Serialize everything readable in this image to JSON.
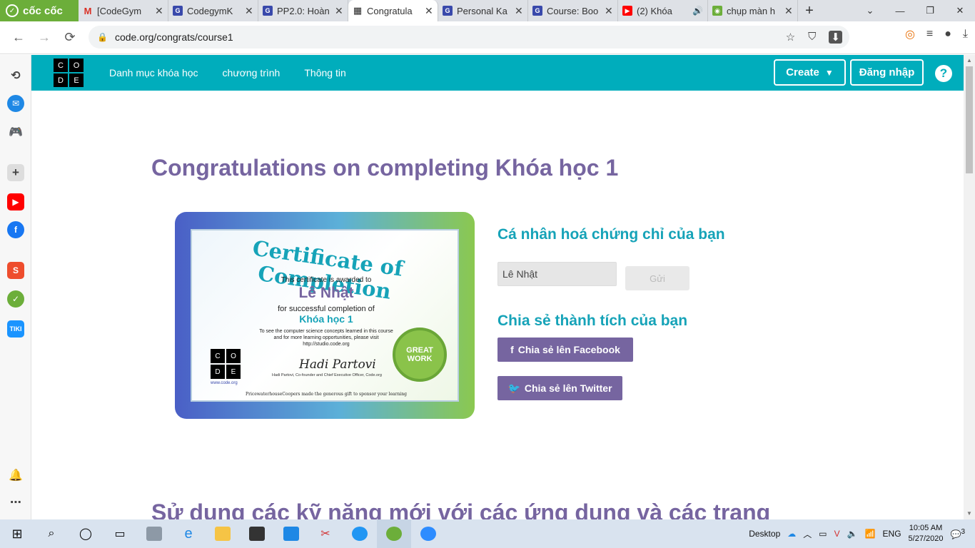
{
  "browser": {
    "brand": "cốc cốc",
    "tabs": [
      {
        "title": "[CodeGym",
        "favicon": "M",
        "color": "#d93025"
      },
      {
        "title": "CodegymK",
        "favicon": "G",
        "color": "#3949ab"
      },
      {
        "title": "PP2.0: Hoàn",
        "favicon": "G",
        "color": "#3949ab"
      },
      {
        "title": "Congratula",
        "favicon": "▦",
        "color": "#222222",
        "active": true
      },
      {
        "title": "Personal Ka",
        "favicon": "G",
        "color": "#3949ab"
      },
      {
        "title": "Course: Boo",
        "favicon": "G",
        "color": "#3949ab"
      },
      {
        "title": "(2) Khóa",
        "favicon": "▶",
        "color": "#ff0000"
      },
      {
        "title": "chụp màn h",
        "favicon": "◉",
        "color": "#6cae3a"
      }
    ],
    "url": "code.org/congrats/course1"
  },
  "site": {
    "logo": [
      "C",
      "O",
      "D",
      "E"
    ],
    "nav": [
      "Danh mục khóa học",
      "chương trình",
      "Thông tin"
    ],
    "create_label": "Create",
    "login_label": "Đăng nhập",
    "help_label": "?"
  },
  "main": {
    "heading": "Congratulations on completing Khóa học 1",
    "personalize_heading": "Cá nhân hoá chứng chỉ của bạn",
    "name_value": "Lê Nhật",
    "submit_label": "Gửi",
    "share_heading": "Chia sẻ thành tích của bạn",
    "facebook_label": "Chia sẻ lên Facebook",
    "twitter_label": "Chia sẻ lên Twitter",
    "bottom_heading": "Sử dụng các kỹ năng mới với các ứng dụng và các trang"
  },
  "certificate": {
    "title": "Certificate of Completion",
    "awarded": "This certificate is awarded to",
    "name": "Lê Nhật",
    "for_line": "for successful completion of",
    "course": "Khóa học 1",
    "note1": "To see the computer science concepts learned in this course",
    "note2": "and for more learning opportunities, please visit",
    "note3": "http://studio.code.org",
    "signature": "Hadi Partovi",
    "signer": "Hadi Partovi, Co-founder and Chief Executive Officer, Code.org",
    "site": "www.code.org",
    "sponsor": "PricewaterhouseCoopers made the generous gift to sponsor your learning",
    "badge_top": "GREAT",
    "badge_bottom": "WORK"
  },
  "taskbar": {
    "desktop_label": "Desktop",
    "lang": "ENG",
    "time": "10:05 AM",
    "date": "5/27/2020",
    "notifications": "3"
  }
}
